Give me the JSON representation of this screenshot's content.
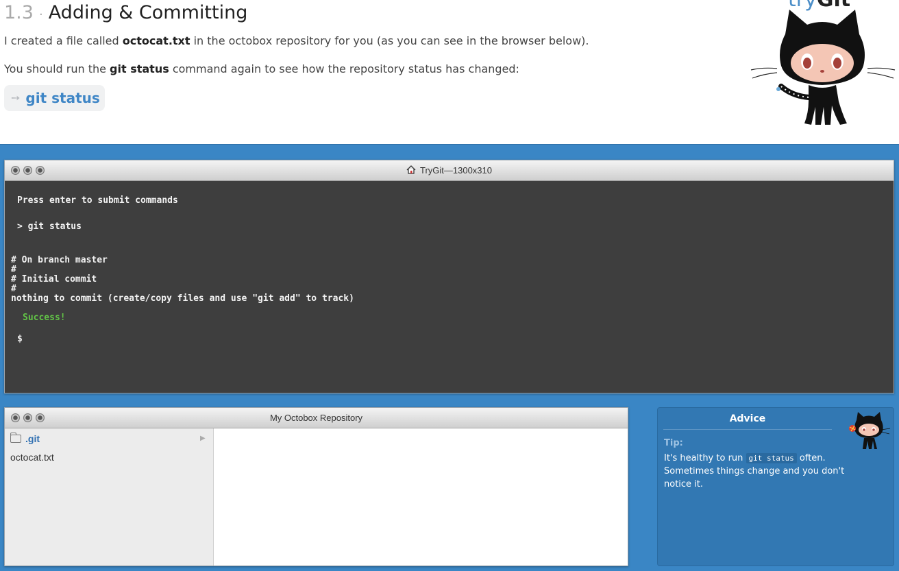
{
  "lesson": {
    "number": "1.3",
    "separator": "·",
    "title": "Adding & Committing",
    "para1_pre": "I created a file called ",
    "para1_bold": "octocat.txt",
    "para1_post": " in the octobox repository for you (as you can see in the browser below).",
    "para2_pre": "You should run the ",
    "para2_bold": "git status",
    "para2_post": " command again to see how the repository status has changed:",
    "command_arrow": "➙",
    "command": "git status"
  },
  "logo": {
    "try": "try",
    "git": "Git",
    "icon": "octocat-icon"
  },
  "terminal": {
    "title": "TryGit—1300x310",
    "title_icon": "home-icon",
    "lines": {
      "intro": "Press enter to submit commands",
      "prompt_cmd": "> git status",
      "out1": "# On branch master",
      "out2": "#",
      "out3": "# Initial commit",
      "out4": "#",
      "out5": "nothing to commit (create/copy files and use \"git add\" to track)",
      "success": "Success!",
      "prompt": "$"
    }
  },
  "repo": {
    "title": "My Octobox Repository",
    "folder": ".git",
    "folder_icon": "folder-icon",
    "file": "octocat.txt",
    "expand_icon": "▶"
  },
  "advice": {
    "title": "Advice",
    "tip_label": "Tip:",
    "text_pre": "It's healthy to run ",
    "text_code": "git status",
    "text_post": " often. Sometimes things change and you don't notice it."
  },
  "colors": {
    "accent_blue": "#3a86c5",
    "terminal_bg": "#3e3e3e",
    "success_green": "#62c447",
    "link_blue": "#3f86c6"
  }
}
